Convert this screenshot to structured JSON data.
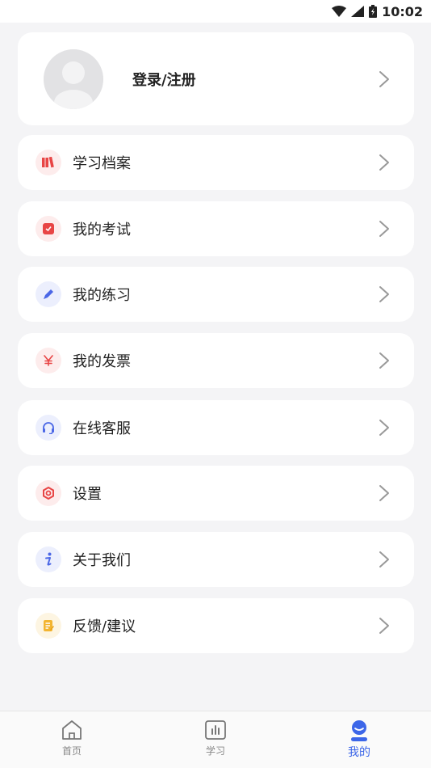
{
  "status_bar": {
    "time": "10:02"
  },
  "profile": {
    "login_label": "登录/注册"
  },
  "menu": [
    {
      "label": "学习档案",
      "icon": "books-icon",
      "icon_bg": "#fdecec",
      "icon_color": "#e84545"
    },
    {
      "label": "我的考试",
      "icon": "exam-icon",
      "icon_bg": "#fdecec",
      "icon_color": "#e84545"
    },
    {
      "label": "我的练习",
      "icon": "pencil-icon",
      "icon_bg": "#eceffd",
      "icon_color": "#4b67e6"
    },
    {
      "label": "我的发票",
      "icon": "yen-icon",
      "icon_bg": "#fdecec",
      "icon_color": "#e84545"
    },
    {
      "label": "在线客服",
      "icon": "headset-icon",
      "icon_bg": "#eceffd",
      "icon_color": "#4b67e6"
    },
    {
      "label": "设置",
      "icon": "settings-icon",
      "icon_bg": "#fdecec",
      "icon_color": "#e84545"
    },
    {
      "label": "关于我们",
      "icon": "info-icon",
      "icon_bg": "#eceffd",
      "icon_color": "#4b67e6"
    },
    {
      "label": "反馈/建议",
      "icon": "feedback-icon",
      "icon_bg": "#fdf5e2",
      "icon_color": "#f3b531"
    }
  ],
  "tabs": [
    {
      "label": "首页",
      "icon": "home-icon"
    },
    {
      "label": "学习",
      "icon": "chart-icon"
    },
    {
      "label": "我的",
      "icon": "profile-icon",
      "active": true
    }
  ],
  "colors": {
    "accent": "#3c66e8",
    "background": "#f4f4f6"
  }
}
